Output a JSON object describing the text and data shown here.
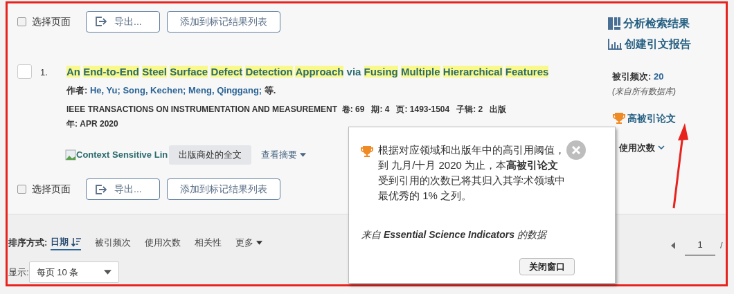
{
  "toolbar_top": {
    "select_page": {
      "label": "选择页面",
      "checked": false
    },
    "export_button": "导出...",
    "add_to_marked_button": "添加到标记结果列表"
  },
  "side_links": [
    {
      "kind": "analyze",
      "label": "分析检索结果"
    },
    {
      "kind": "report",
      "label": "创建引文报告"
    }
  ],
  "record": {
    "number": "1.",
    "checked": false,
    "title_words": [
      {
        "text": "An",
        "highlighted": true
      },
      {
        "text": "End-to-End",
        "highlighted": true
      },
      {
        "text": "Steel",
        "highlighted": true
      },
      {
        "text": "Surface",
        "highlighted": true
      },
      {
        "text": "Defect",
        "highlighted": true
      },
      {
        "text": "Detection",
        "highlighted": true
      },
      {
        "text": "Approach",
        "highlighted": true
      },
      {
        "text": "via",
        "highlighted": false
      },
      {
        "text": "Fusing",
        "highlighted": true
      },
      {
        "text": "Multiple",
        "highlighted": true
      },
      {
        "text": "Hierarchical",
        "highlighted": true
      },
      {
        "text": "Features",
        "highlighted": true
      }
    ],
    "authors_label": "作者:",
    "authors": "He, Yu; Song, Kechen; Meng, Qinggang;",
    "authors_more": "等.",
    "source": "IEEE TRANSACTIONS ON INSTRUMENTATION AND MEASUREMENT  卷: 69   期: 4   页: 1493-1504   子辑: 2   出版年: APR 2020",
    "context_link": "Context Sensitive Lin",
    "full_text_button": "出版商处的全文",
    "abstract_toggle": "查看摘要",
    "times_cited_label": "被引频次:",
    "times_cited": "20",
    "cited_note": "(来自所有数据库)",
    "badge": "高被引论文",
    "usage": "使用次数"
  },
  "toolbar_bottom": {
    "select_page": {
      "label": "选择页面",
      "checked": false
    },
    "export_button": "导出...",
    "add_to_marked_button": "添加到标记结果列表"
  },
  "sort": {
    "label": "排序方式:",
    "options": [
      {
        "label": "日期",
        "selected": true
      },
      {
        "label": "被引频次",
        "selected": false
      },
      {
        "label": "使用次数",
        "selected": false
      },
      {
        "label": "相关性",
        "selected": false
      }
    ],
    "more": "更多"
  },
  "display": {
    "label": "显示:",
    "value": "每页 10 条"
  },
  "pagination": {
    "page": "1",
    "separator": "/"
  },
  "popup": {
    "message": "根据对应领域和出版年中的高引用阈值，到 九月/十月 2020 为止，本**高被引论文**受到引用的次数已将其归入其学术领域中最优秀的 1% 之列。",
    "source": "来自 **Essential Science Indicators** 的数据",
    "close_button": "关闭窗口"
  }
}
